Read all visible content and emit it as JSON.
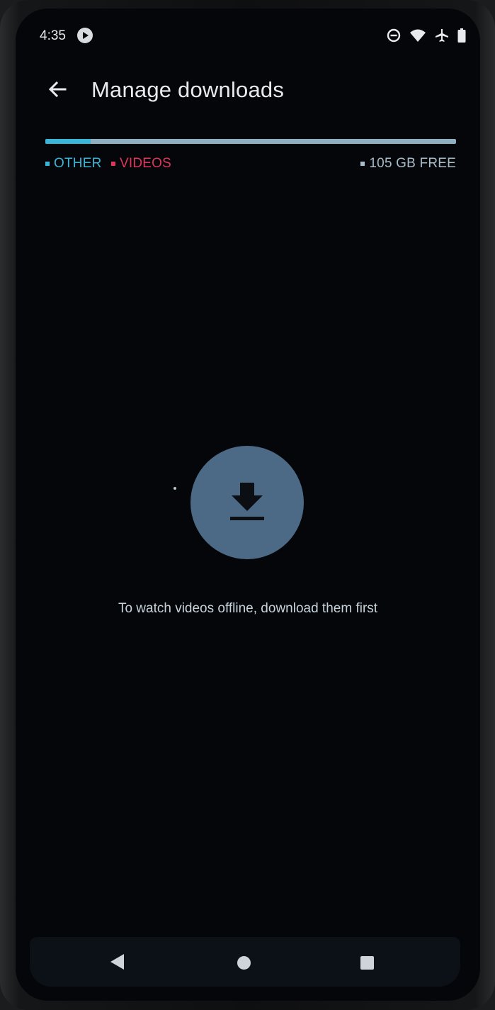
{
  "status_bar": {
    "time": "4:35",
    "icons": [
      "app-notification-icon",
      "do-not-disturb-icon",
      "wifi-icon",
      "airplane-mode-icon",
      "battery-icon"
    ]
  },
  "app_bar": {
    "title": "Manage downloads",
    "back_icon": "arrow-back-icon"
  },
  "storage": {
    "other_fraction": 0.11,
    "videos_fraction": 0.0,
    "colors": {
      "other": "#3ab5d8",
      "videos": "#e0355a",
      "free": "#a8bcc9"
    },
    "legend": {
      "other_label": "OTHER",
      "videos_label": "VIDEOS",
      "free_label": "105 GB FREE"
    }
  },
  "empty_state": {
    "icon": "download-icon",
    "message": "To watch videos offline, download them first"
  },
  "nav_bar": {
    "buttons": [
      "nav-back-icon",
      "nav-home-icon",
      "nav-recents-icon"
    ]
  }
}
